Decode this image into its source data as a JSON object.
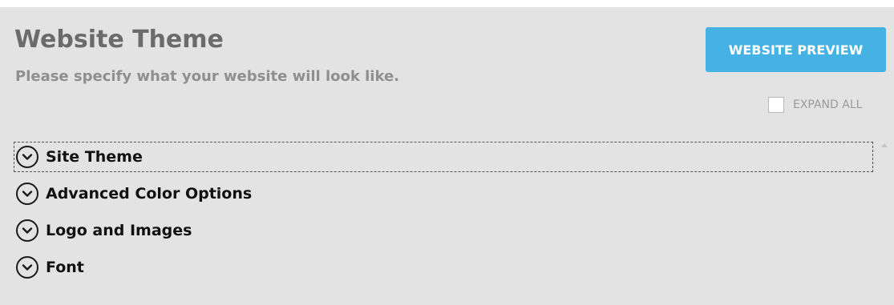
{
  "header": {
    "title": "Website Theme",
    "subtitle": "Please specify what your website will look like."
  },
  "actions": {
    "preview_label": "WEBSITE PREVIEW",
    "expand_all_label": "EXPAND ALL",
    "expand_all_checked": false
  },
  "sections": [
    {
      "label": "Site Theme",
      "icon": "chevron-down-icon"
    },
    {
      "label": "Advanced Color Options",
      "icon": "chevron-down-icon"
    },
    {
      "label": "Logo and Images",
      "icon": "chevron-down-icon"
    },
    {
      "label": "Font",
      "icon": "chevron-down-icon"
    }
  ],
  "colors": {
    "panel_background": "#e3e3e3",
    "preview_button": "#46b2e4",
    "title_text": "#6b6b6b",
    "subtitle_text": "#8f8f8f"
  }
}
